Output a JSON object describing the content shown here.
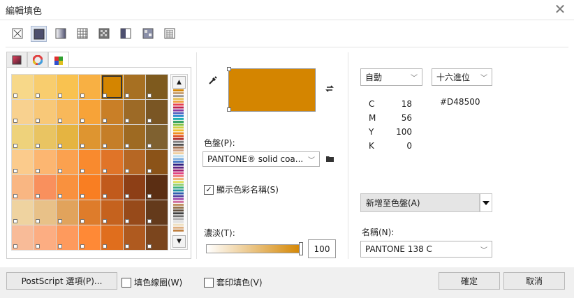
{
  "window": {
    "title": "編輯填色",
    "close_symbol": "✕"
  },
  "toolbar": {
    "items": [
      {
        "name": "no-fill-icon"
      },
      {
        "name": "uniform-fill-icon"
      },
      {
        "name": "fountain-fill-icon"
      },
      {
        "name": "vector-pattern-icon"
      },
      {
        "name": "bitmap-pattern-icon"
      },
      {
        "name": "two-color-pattern-icon"
      },
      {
        "name": "texture-fill-icon"
      },
      {
        "name": "postscript-fill-icon"
      }
    ]
  },
  "tabs": [
    {
      "name": "color-models-tab",
      "icon": "gradient-square-icon"
    },
    {
      "name": "color-wheel-tab",
      "icon": "color-wheel-icon"
    },
    {
      "name": "palettes-tab",
      "icon": "palette-grid-icon"
    }
  ],
  "palette_grid": {
    "colors": [
      [
        "#F7D889",
        "#F8CD6E",
        "#F9C250",
        "#F8B043",
        "#D48500",
        "#A77022",
        "#7E5A1E"
      ],
      [
        "#F8D18F",
        "#F8C878",
        "#F8B85A",
        "#F7A338",
        "#C97F27",
        "#9D6A26",
        "#7A5624"
      ],
      [
        "#EED27B",
        "#E9C462",
        "#E5B441",
        "#DE9530",
        "#C57E28",
        "#9E6A22",
        "#7F6130"
      ],
      [
        "#FBCB8C",
        "#FCB671",
        "#FBA14F",
        "#F98A2E",
        "#E07428",
        "#B66724",
        "#8B5318"
      ],
      [
        "#F9B682",
        "#F9905D",
        "#F9913E",
        "#F97E22",
        "#C15A1C",
        "#8D3F16",
        "#5B2E13"
      ],
      [
        "#EFD3A0",
        "#E8C188",
        "#E1A35C",
        "#DE7C2B",
        "#C5621E",
        "#974A1A",
        "#643A1B"
      ],
      [
        "#F8BB98",
        "#FCAD82",
        "#FE9A5D",
        "#FF8936",
        "#E06E1D",
        "#AF5A1F",
        "#7B451D"
      ]
    ],
    "selected": [
      0,
      4
    ]
  },
  "color_strip": {
    "colors": [
      "#d48500",
      "#c8a070",
      "#9a9a9a",
      "#e6c25a",
      "#f0a040",
      "#e84050",
      "#c02050",
      "#8a3aa0",
      "#5060c0",
      "#3090d0",
      "#20b0b0",
      "#30a060",
      "#80c040",
      "#d0d040",
      "#f0c030",
      "#f09020",
      "#e05020",
      "#b03030",
      "#808080",
      "#505050",
      "#a07050",
      "#d0a080",
      "#f0d0a0",
      "#c0e0f0",
      "#80b0e0",
      "#4070c0",
      "#302080",
      "#602080",
      "#a02070",
      "#e04080",
      "#f08080",
      "#f0b070",
      "#e0e060",
      "#90d070",
      "#40b080",
      "#2090a0",
      "#3060b0",
      "#5040a0",
      "#a050b0",
      "#d070a0",
      "#c09060",
      "#90704a",
      "#605040",
      "#404040",
      "#707070",
      "#b0b0b0",
      "#e0e0e0",
      "#f0e0c0",
      "#e0b080",
      "#c08040"
    ]
  },
  "eyedropper": {
    "icon": "eyedropper-icon"
  },
  "swap": {
    "icon": "swap-arrows-icon"
  },
  "current_color": "#D48500",
  "palette": {
    "label": "色盤(P):",
    "value": "PANTONE® solid coa...",
    "folder_icon": "folder-icon"
  },
  "show_names": {
    "label": "顯示色彩名稱(S)",
    "checked": true
  },
  "tint": {
    "label": "濃淡(T):",
    "value": "100",
    "fraction": 1.0
  },
  "model": {
    "mode_value": "自動",
    "format_value": "十六進位",
    "components": [
      {
        "k": "C",
        "v": "18"
      },
      {
        "k": "M",
        "v": "56"
      },
      {
        "k": "Y",
        "v": "100"
      },
      {
        "k": "K",
        "v": "0"
      }
    ],
    "hex": "#D48500"
  },
  "add_to_palette": {
    "label": "新增至色盤(A)"
  },
  "name_field": {
    "label": "名稱(N):",
    "value": "PANTONE 138 C"
  },
  "footer": {
    "postscript_label": "PostScript 選項(P)...",
    "wireframe_label": "填色線圈(W)",
    "overprint_label": "套印填色(V)",
    "ok_label": "確定",
    "cancel_label": "取消"
  }
}
